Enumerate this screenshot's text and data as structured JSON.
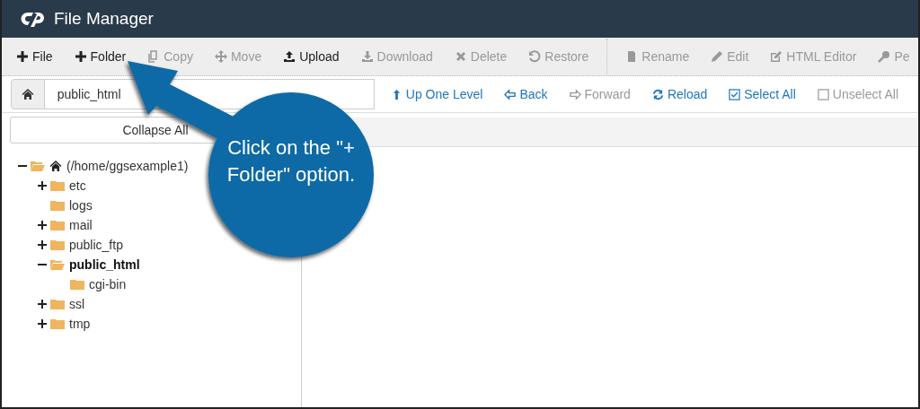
{
  "app": {
    "title": "File Manager"
  },
  "toolbar": [
    {
      "label": "File",
      "disabled": false
    },
    {
      "label": "Folder",
      "disabled": false
    },
    {
      "label": "Copy",
      "disabled": true
    },
    {
      "label": "Move",
      "disabled": true
    },
    {
      "label": "Upload",
      "disabled": false
    },
    {
      "label": "Download",
      "disabled": true
    },
    {
      "label": "Delete",
      "disabled": true
    },
    {
      "label": "Restore",
      "disabled": true
    },
    {
      "label": "Rename",
      "disabled": true
    },
    {
      "label": "Edit",
      "disabled": true
    },
    {
      "label": "HTML Editor",
      "disabled": true
    },
    {
      "label": "Pe",
      "disabled": true
    }
  ],
  "path_field": {
    "value": "public_html"
  },
  "nav": [
    {
      "label": "Up One Level",
      "disabled": false
    },
    {
      "label": "Back",
      "disabled": false
    },
    {
      "label": "Forward",
      "disabled": true
    },
    {
      "label": "Reload",
      "disabled": false
    },
    {
      "label": "Select All",
      "disabled": false
    },
    {
      "label": "Unselect All",
      "disabled": true
    }
  ],
  "collapse_button": "Collapse All",
  "tree": [
    {
      "label": "(/home/ggsexample1)",
      "kind": "home",
      "expandable": true,
      "expanded": true,
      "selected": false,
      "children": [
        {
          "label": "etc",
          "kind": "folder",
          "expandable": true,
          "expanded": false,
          "selected": false
        },
        {
          "label": "logs",
          "kind": "folder",
          "expandable": false,
          "expanded": false,
          "selected": false
        },
        {
          "label": "mail",
          "kind": "folder",
          "expandable": true,
          "expanded": false,
          "selected": false
        },
        {
          "label": "public_ftp",
          "kind": "folder",
          "expandable": true,
          "expanded": false,
          "selected": false
        },
        {
          "label": "public_html",
          "kind": "folder",
          "expandable": true,
          "expanded": true,
          "selected": true,
          "children": [
            {
              "label": "cgi-bin",
              "kind": "folder",
              "expandable": false,
              "expanded": false,
              "selected": false
            }
          ]
        },
        {
          "label": "ssl",
          "kind": "folder",
          "expandable": true,
          "expanded": false,
          "selected": false
        },
        {
          "label": "tmp",
          "kind": "folder",
          "expandable": true,
          "expanded": false,
          "selected": false
        }
      ]
    }
  ],
  "callout": {
    "text": "Click on the \"+ Folder\" option."
  }
}
